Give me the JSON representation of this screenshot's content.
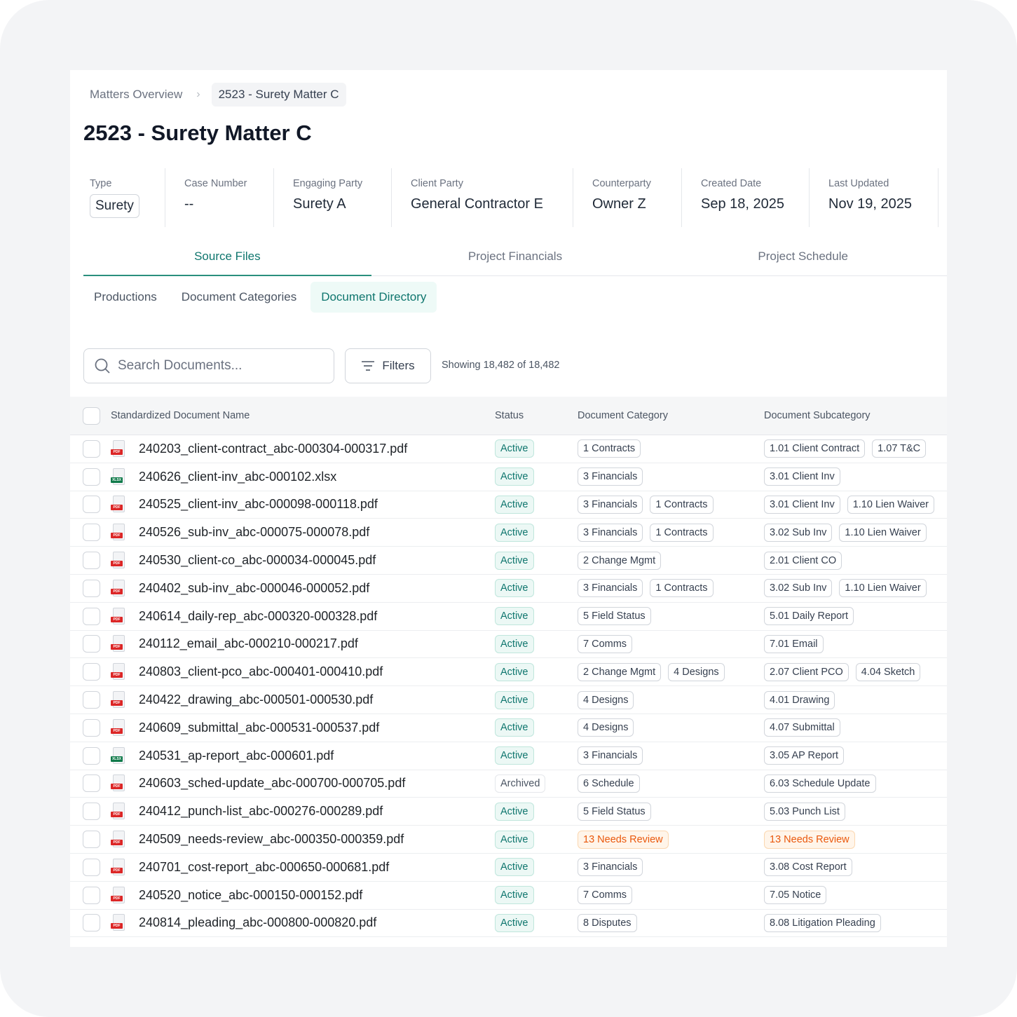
{
  "breadcrumb": {
    "parent": "Matters Overview",
    "separator": "›",
    "current": "2523 - Surety Matter C"
  },
  "title": "2523 - Surety Matter C",
  "meta": [
    {
      "label": "Type",
      "value": "Surety"
    },
    {
      "label": "Case Number",
      "value": "--"
    },
    {
      "label": "Engaging Party",
      "value": "Surety A"
    },
    {
      "label": "Client Party",
      "value": "General Contractor E"
    },
    {
      "label": "Counterparty",
      "value": "Owner Z"
    },
    {
      "label": "Created Date",
      "value": "Sep 18, 2025"
    },
    {
      "label": "Last Updated",
      "value": "Nov 19, 2025"
    }
  ],
  "tabs": [
    "Source Files",
    "Project Financials",
    "Project Schedule"
  ],
  "active_tab": "Source Files",
  "subtabs": [
    "Productions",
    "Document Categories",
    "Document Directory"
  ],
  "active_subtab": "Document Directory",
  "search": {
    "placeholder": "Search Documents..."
  },
  "filters_label": "Filters",
  "showing": "Showing 18,482 of 18,482",
  "columns": [
    "Standardized Document Name",
    "Status",
    "Document Category",
    "Document Subcategory"
  ],
  "colors": {
    "accent": "#0f766e",
    "review": "#ea580c",
    "pdf": "#dc2626",
    "xlsx": "#0f7a4a"
  },
  "rows": [
    {
      "icon": "pdf",
      "name": "240203_client-contract_abc-000304-000317.pdf",
      "status": "Active",
      "categories": [
        "1 Contracts"
      ],
      "subcategories": [
        "1.01 Client Contract",
        "1.07 T&C"
      ]
    },
    {
      "icon": "xlsx",
      "name": "240626_client-inv_abc-000102.xlsx",
      "status": "Active",
      "categories": [
        "3 Financials"
      ],
      "subcategories": [
        "3.01 Client Inv"
      ]
    },
    {
      "icon": "pdf",
      "name": "240525_client-inv_abc-000098-000118.pdf",
      "status": "Active",
      "categories": [
        "3 Financials",
        "1 Contracts"
      ],
      "subcategories": [
        "3.01 Client Inv",
        "1.10 Lien Waiver"
      ]
    },
    {
      "icon": "pdf",
      "name": "240526_sub-inv_abc-000075-000078.pdf",
      "status": "Active",
      "categories": [
        "3 Financials",
        "1 Contracts"
      ],
      "subcategories": [
        "3.02 Sub Inv",
        "1.10 Lien Waiver"
      ]
    },
    {
      "icon": "pdf",
      "name": "240530_client-co_abc-000034-000045.pdf",
      "status": "Active",
      "categories": [
        "2 Change Mgmt"
      ],
      "subcategories": [
        "2.01 Client CO"
      ]
    },
    {
      "icon": "pdf",
      "name": "240402_sub-inv_abc-000046-000052.pdf",
      "status": "Active",
      "categories": [
        "3 Financials",
        "1 Contracts"
      ],
      "subcategories": [
        "3.02 Sub Inv",
        "1.10 Lien Waiver"
      ]
    },
    {
      "icon": "pdf",
      "name": "240614_daily-rep_abc-000320-000328.pdf",
      "status": "Active",
      "categories": [
        "5 Field Status"
      ],
      "subcategories": [
        "5.01 Daily Report"
      ]
    },
    {
      "icon": "pdf",
      "name": "240112_email_abc-000210-000217.pdf",
      "status": "Active",
      "categories": [
        "7 Comms"
      ],
      "subcategories": [
        "7.01 Email"
      ]
    },
    {
      "icon": "pdf",
      "name": "240803_client-pco_abc-000401-000410.pdf",
      "status": "Active",
      "categories": [
        "2 Change Mgmt",
        "4 Designs"
      ],
      "subcategories": [
        "2.07 Client PCO",
        "4.04 Sketch"
      ]
    },
    {
      "icon": "pdf",
      "name": "240422_drawing_abc-000501-000530.pdf",
      "status": "Active",
      "categories": [
        "4 Designs"
      ],
      "subcategories": [
        "4.01 Drawing"
      ]
    },
    {
      "icon": "pdf",
      "name": "240609_submittal_abc-000531-000537.pdf",
      "status": "Active",
      "categories": [
        "4 Designs"
      ],
      "subcategories": [
        "4.07 Submittal"
      ]
    },
    {
      "icon": "xlsx",
      "name": "240531_ap-report_abc-000601.pdf",
      "status": "Active",
      "categories": [
        "3 Financials"
      ],
      "subcategories": [
        "3.05 AP Report"
      ]
    },
    {
      "icon": "pdf",
      "name": "240603_sched-update_abc-000700-000705.pdf",
      "status": "Archived",
      "categories": [
        "6 Schedule"
      ],
      "subcategories": [
        "6.03 Schedule Update"
      ]
    },
    {
      "icon": "pdf",
      "name": "240412_punch-list_abc-000276-000289.pdf",
      "status": "Active",
      "categories": [
        "5 Field Status"
      ],
      "subcategories": [
        "5.03 Punch List"
      ]
    },
    {
      "icon": "pdf",
      "name": "240509_needs-review_abc-000350-000359.pdf",
      "status": "Active",
      "categories": [
        "13 Needs Review"
      ],
      "subcategories": [
        "13 Needs Review"
      ],
      "review": true
    },
    {
      "icon": "pdf",
      "name": "240701_cost-report_abc-000650-000681.pdf",
      "status": "Active",
      "categories": [
        "3 Financials"
      ],
      "subcategories": [
        "3.08 Cost Report"
      ]
    },
    {
      "icon": "pdf",
      "name": "240520_notice_abc-000150-000152.pdf",
      "status": "Active",
      "categories": [
        "7 Comms"
      ],
      "subcategories": [
        "7.05 Notice"
      ]
    },
    {
      "icon": "pdf",
      "name": "240814_pleading_abc-000800-000820.pdf",
      "status": "Active",
      "categories": [
        "8 Disputes"
      ],
      "subcategories": [
        "8.08 Litigation Pleading"
      ]
    }
  ]
}
